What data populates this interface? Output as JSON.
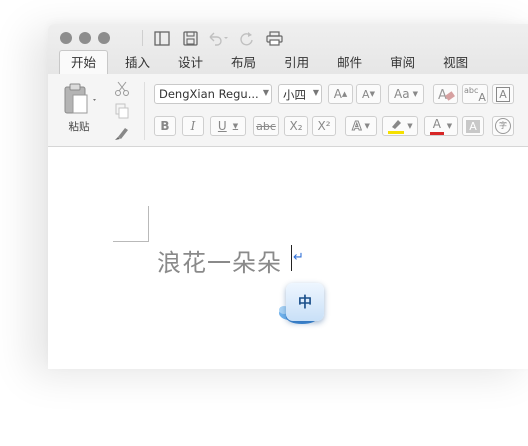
{
  "toolbar": {
    "tabs": [
      "开始",
      "插入",
      "设计",
      "布局",
      "引用",
      "邮件",
      "审阅",
      "视图"
    ],
    "active_tab": "开始"
  },
  "ribbon": {
    "paste_label": "粘贴",
    "font_name": "DengXian Regu...",
    "font_size": "小四",
    "bold": "B",
    "italic": "I",
    "underline": "U",
    "strikethrough": "abc",
    "subscript": "X₂",
    "superscript": "X²",
    "grow": "A",
    "shrink": "A",
    "change_case": "Aa",
    "phonetic": "abc",
    "char_border": "A",
    "text_effect": "A",
    "font_color": "A",
    "char_shading": "A",
    "enclose": "字"
  },
  "document": {
    "text": "浪花一朵朵",
    "paragraph_mark": "↵"
  },
  "ime": {
    "label": "中"
  },
  "colors": {
    "accent": "#2f6fd6",
    "highlight": "#f5e000",
    "font_color": "#d72626"
  }
}
